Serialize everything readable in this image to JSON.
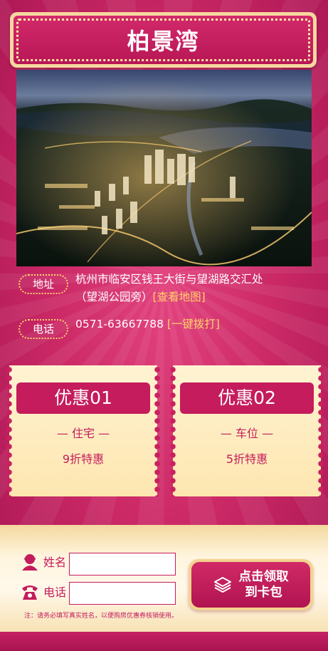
{
  "header": {
    "title": "柏景湾"
  },
  "photo": {
    "alt_icon": "aerial-city-night-image"
  },
  "address": {
    "label": "地址",
    "line1": "杭州市临安区钱王大街与望湖路交汇处",
    "line2": "（望湖公园旁）",
    "map_link": "[查看地图]"
  },
  "phone": {
    "label": "电话",
    "number": "0571-63667788",
    "call_link": "[一键拨打]"
  },
  "coupons": [
    {
      "title": "优惠01",
      "type": "— 住宅 —",
      "offer": "9折特惠"
    },
    {
      "title": "优惠02",
      "type": "— 车位 —",
      "offer": "5折特惠"
    }
  ],
  "form": {
    "name_label": "姓名",
    "name_value": "",
    "phone_label": "电话",
    "phone_value": "",
    "submit_label": "点击领取\n到卡包",
    "note": "注：请务必填写真实姓名，以便购房优惠券核销使用。"
  },
  "colors": {
    "brand": "#c41c5c",
    "gold": "#ffd26a",
    "cream": "#fff0cc"
  }
}
